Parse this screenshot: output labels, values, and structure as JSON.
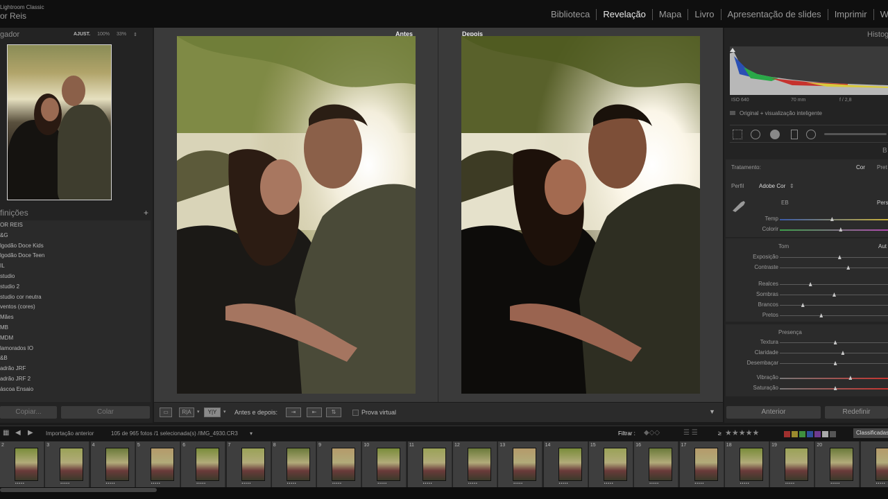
{
  "app": {
    "name": "Lightroom Classic",
    "user": "or Reis"
  },
  "modules": [
    "Biblioteca",
    "Revelação",
    "Mapa",
    "Livro",
    "Apresentação de slides",
    "Imprimir",
    "W"
  ],
  "active_module": "Revelação",
  "navigator": {
    "title": "gador",
    "opts": [
      "AJUST.",
      "100%",
      "33%"
    ]
  },
  "presets": {
    "title": "finições",
    "items": [
      "OR REIS",
      "&G",
      "lgodão Doce Kids",
      "lgodão Doce Teen",
      "IL",
      "studio",
      "studio 2",
      "studio cor neutra",
      "ventos (cores)",
      "Mães",
      "MB",
      "MDM",
      "lamorados IO",
      "&B",
      "adrão JRF",
      "adrão JRF 2",
      "áscoa Ensaio"
    ]
  },
  "left_buttons": {
    "copy": "Copiar...",
    "paste": "Colar"
  },
  "compare": {
    "before": "Antes",
    "after": "Depois"
  },
  "toolbar": {
    "before_after_label": "Antes e depois:",
    "soft_proof": "Prova virtual",
    "ra": "R|A",
    "yy": "Y|Y"
  },
  "histogram": {
    "title": "Histog",
    "iso": "ISO 640",
    "focal": "70 mm",
    "aperture": "f / 2,8",
    "smart_preview": "Original + visualização inteligente"
  },
  "basic": {
    "treatment_label": "Tratamento:",
    "treatment_color": "Cor",
    "treatment_bw": "Pret",
    "profile_label": "Perfil",
    "profile_value": "Adobe Cor",
    "wb_label": "EB",
    "wb_value": "Pers",
    "tone_label": "Tom",
    "tone_auto": "Aut",
    "presence_label": "Presença",
    "section_initial": "B"
  },
  "sliders": [
    {
      "label": "Temp",
      "value": 0.48
    },
    {
      "label": "Colorir",
      "value": 0.56
    },
    {
      "label": "Exposição",
      "value": 0.55
    },
    {
      "label": "Contraste",
      "value": 0.63
    },
    {
      "label": "Realces",
      "value": 0.28
    },
    {
      "label": "Sombras",
      "value": 0.5
    },
    {
      "label": "Brancos",
      "value": 0.21
    },
    {
      "label": "Pretos",
      "value": 0.38
    },
    {
      "label": "Textura",
      "value": 0.51
    },
    {
      "label": "Claridade",
      "value": 0.58
    },
    {
      "label": "Desembaçar",
      "value": 0.51
    },
    {
      "label": "Vibração",
      "value": 0.65
    },
    {
      "label": "Saturação",
      "value": 0.51
    }
  ],
  "right_buttons": {
    "previous": "Anterior",
    "reset": "Redefinir"
  },
  "filmbar": {
    "import": "Importação anterior",
    "count": "105 de 965 fotos /1 selecionada(s) /IMG_4930.CR3",
    "filter": "Filtrar :",
    "rating_op": "≥",
    "stars": "★★★★★",
    "rated": "Classificadas"
  },
  "filmstrip": [
    "2",
    "3",
    "4",
    "5",
    "6",
    "7",
    "8",
    "9",
    "10",
    "11",
    "12",
    "13",
    "14",
    "15",
    "16",
    "17",
    "18",
    "19",
    "20",
    ""
  ]
}
